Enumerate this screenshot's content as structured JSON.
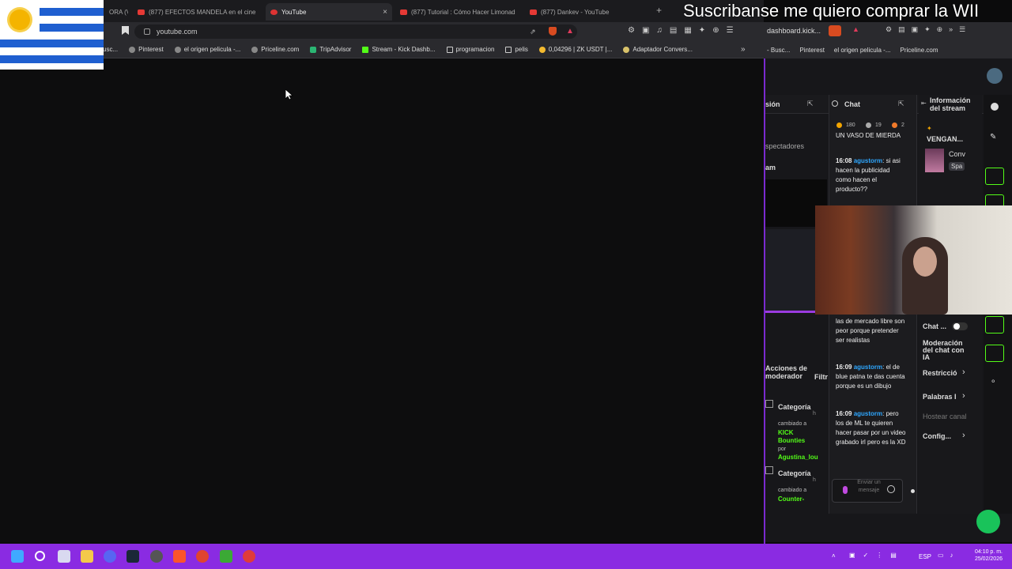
{
  "overlay_text": "Suscribanse me quiero comprar la WII",
  "tabs": [
    {
      "label": "ORA (V",
      "active": false
    },
    {
      "label": "(877) EFECTOS MANDELA en el cine",
      "active": false
    },
    {
      "label": "YouTube",
      "active": true
    },
    {
      "label": "(877) Tutorial : Cómo Hacer Limonad",
      "active": false
    },
    {
      "label": "(877) Dankev - YouTube",
      "active": false
    }
  ],
  "address": {
    "url": "youtube.com"
  },
  "bookmarks": [
    "usc...",
    "Pinterest",
    "el origen pelicula -...",
    "Priceline.com",
    "TripAdvisor",
    "Stream - Kick Dashb...",
    "programacion",
    "pelis",
    "0,04296 | ZK USDT |...",
    "Adaptador Convers..."
  ],
  "right_window": {
    "address": "dashboard.kick...",
    "bookmarks": [
      "- Busc...",
      "Pinterest",
      "el origen pelicula -...",
      "Priceline.com"
    ],
    "left_labels": {
      "sion": "sión",
      "spectators": "spectadores",
      "am": "am",
      "actions": "Acciones de moderador",
      "filt": "Filtr"
    },
    "categories": [
      {
        "title": "Categoría",
        "note": "h",
        "changed": "cambiado a",
        "value": "KICK Bounties",
        "by": "por",
        "user": "Agustina_lou"
      },
      {
        "title": "Categoría",
        "note": "h",
        "changed": "cambiado a",
        "value": "Counter-"
      }
    ],
    "chat": {
      "title": "Chat",
      "stats": [
        "180",
        "19",
        "2"
      ],
      "messages": [
        {
          "time": "",
          "user": "",
          "text": "UN VASO DE MIERDA"
        },
        {
          "time": "16:08",
          "user": "agustorm",
          "text": "si asi hacen la publicidad como hacen el producto??"
        },
        {
          "time": "",
          "user": "",
          "text": "las de mercado libre son peor porque pretender ser realistas"
        },
        {
          "time": "16:09",
          "user": "agustorm",
          "text": "el de blue patna te das cuenta porque es un dibujo"
        },
        {
          "time": "16:09",
          "user": "agustorm",
          "text": "pero los de ML te quieren hacer pasar por un video grabado irl pero es la XD"
        }
      ],
      "input_placeholder": "Enviar un mensaje"
    },
    "info": {
      "title": "Información del stream",
      "stream_title": "VENGAN...",
      "conv": "Conv",
      "spa": "Spa",
      "chat_toggle": "Chat ...",
      "moderation": "Moderación del chat con IA",
      "restriction": "Restricció",
      "words": "Palabras I",
      "host": "Hostear canal",
      "config": "Config..."
    }
  },
  "taskbar": {
    "lang": "ESP",
    "time": "04:10 p. m.",
    "date": "25/02/2026"
  }
}
